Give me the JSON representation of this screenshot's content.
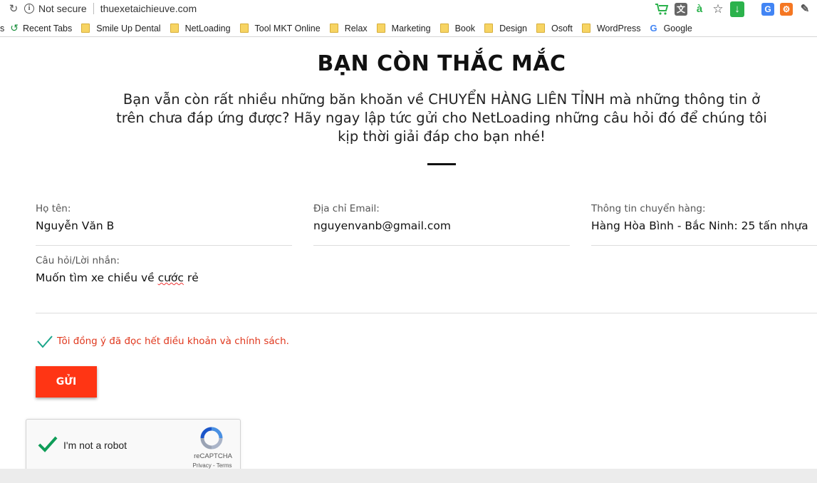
{
  "browser": {
    "security_label": "Not secure",
    "url": "thuexetaichieuve.com",
    "bookmarks": {
      "leading_fragment": "s",
      "recent_tabs": "Recent Tabs",
      "items": [
        "Smile Up Dental",
        "NetLoading",
        "Tool MKT Online",
        "Relax",
        "Marketing",
        "Book",
        "Design",
        "Osoft",
        "WordPress"
      ],
      "google": "Google"
    },
    "icons": [
      "reload-icon",
      "info-icon",
      "cart-extension-icon",
      "translate-extension-icon",
      "a-extension-icon",
      "star-icon",
      "download-icon",
      "google-translate-icon",
      "hubspot-icon",
      "eyedropper-icon"
    ]
  },
  "page": {
    "title": "BẠN CÒN THẮC MẮC",
    "intro": "Bạn vẫn còn rất nhiều những băn khoăn về CHUYỂN HÀNG LIÊN TỈNH mà những thông tin ở trên chưa đáp ứng được? Hãy ngay lập tức gửi cho NetLoading những câu hỏi đó để chúng tôi kịp thời giải đáp cho bạn nhé!"
  },
  "form": {
    "name": {
      "label": "Họ tên:",
      "value": "Nguyễn Văn B"
    },
    "email": {
      "label": "Địa chỉ Email:",
      "value": "nguyenvanb@gmail.com"
    },
    "shipping": {
      "label": "Thông tin chuyển hàng:",
      "value": "Hàng Hòa Bình - Bắc Ninh: 25 tấn nhựa"
    },
    "message": {
      "label": "Câu hỏi/Lời nhắn:",
      "value_main": "Muốn tìm xe chiều về ",
      "value_flagged": "cước",
      "value_tail": " rẻ"
    },
    "consent": {
      "text": "Tôi đồng ý đã đọc hết điều khoản và chính sách.",
      "checked": true
    },
    "submit_label": "GỬI",
    "accent_color": "#ff3514",
    "consent_color": "#e0381e"
  },
  "recaptcha": {
    "label": "I'm not a robot",
    "checked": true,
    "brand": "reCAPTCHA",
    "links": "Privacy - Terms"
  }
}
